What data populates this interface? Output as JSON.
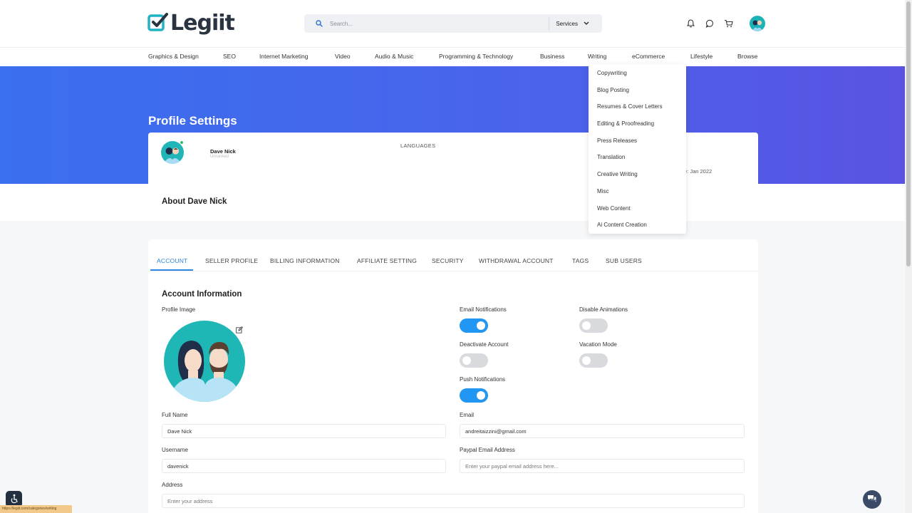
{
  "header": {
    "logo_text": "Legiit",
    "search_placeholder": "Search...",
    "services_label": "Services"
  },
  "nav": {
    "items": [
      "Graphics & Design",
      "SEO",
      "Internet Marketing",
      "Video",
      "Audio & Music",
      "Programming & Technology",
      "Business",
      "Writing",
      "eCommerce",
      "Lifestyle",
      "Browse"
    ]
  },
  "dropdown": {
    "items": [
      "Copywriting",
      "Blog Posting",
      "Resumes & Cover Letters",
      "Editing & Proofreading",
      "Press Releases",
      "Translation",
      "Creative Writing",
      "Misc",
      "Web Content",
      "Ai Content Creation"
    ]
  },
  "page": {
    "title": "Profile Settings"
  },
  "profile": {
    "name": "Dave Nick",
    "subtitle": "Unranked",
    "languages_label": "LANGUAGES",
    "member_since": "e: Jan 2022",
    "about_title": "About Dave Nick"
  },
  "tabs": [
    "ACCOUNT",
    "SELLER PROFILE",
    "BILLING INFORMATION",
    "AFFILIATE SETTING",
    "SECURITY",
    "WITHDRAWAL ACCOUNT",
    "TAGS",
    "SUB USERS"
  ],
  "account": {
    "section_title": "Account Information",
    "profile_image_label": "Profile Image",
    "toggles": {
      "email_notifications": {
        "label": "Email Notifications",
        "on": true
      },
      "disable_animations": {
        "label": "Disable Animations",
        "on": false
      },
      "deactivate_account": {
        "label": "Deactivate Account",
        "on": false
      },
      "vacation_mode": {
        "label": "Vacation Mode",
        "on": false
      },
      "push_notifications": {
        "label": "Push Notifications",
        "on": true
      }
    },
    "full_name": {
      "label": "Full Name",
      "value": "Dave Nick"
    },
    "email": {
      "label": "Email",
      "value": "andreitaizzini@gmail.com"
    },
    "username": {
      "label": "Username",
      "value": "davenick"
    },
    "paypal": {
      "label": "Paypal Email Address",
      "placeholder": "Enter your paypal email address here..."
    },
    "address": {
      "label": "Address",
      "placeholder": "Enter your address"
    }
  },
  "status_bar": {
    "url": "https://legiit.com/categories/writing"
  },
  "colors": {
    "accent": "#2196f3",
    "banner_start": "#3a6fef",
    "banner_end": "#5a53e2",
    "logo_teal": "#20b3c4",
    "toggle_off": "#d8dadd"
  },
  "icons": [
    "logo-check-icon",
    "search-icon",
    "chevron-down-icon",
    "bell-icon",
    "chat-bubble-icon",
    "cart-icon",
    "edit-icon",
    "accessibility-icon",
    "chat-icon"
  ]
}
